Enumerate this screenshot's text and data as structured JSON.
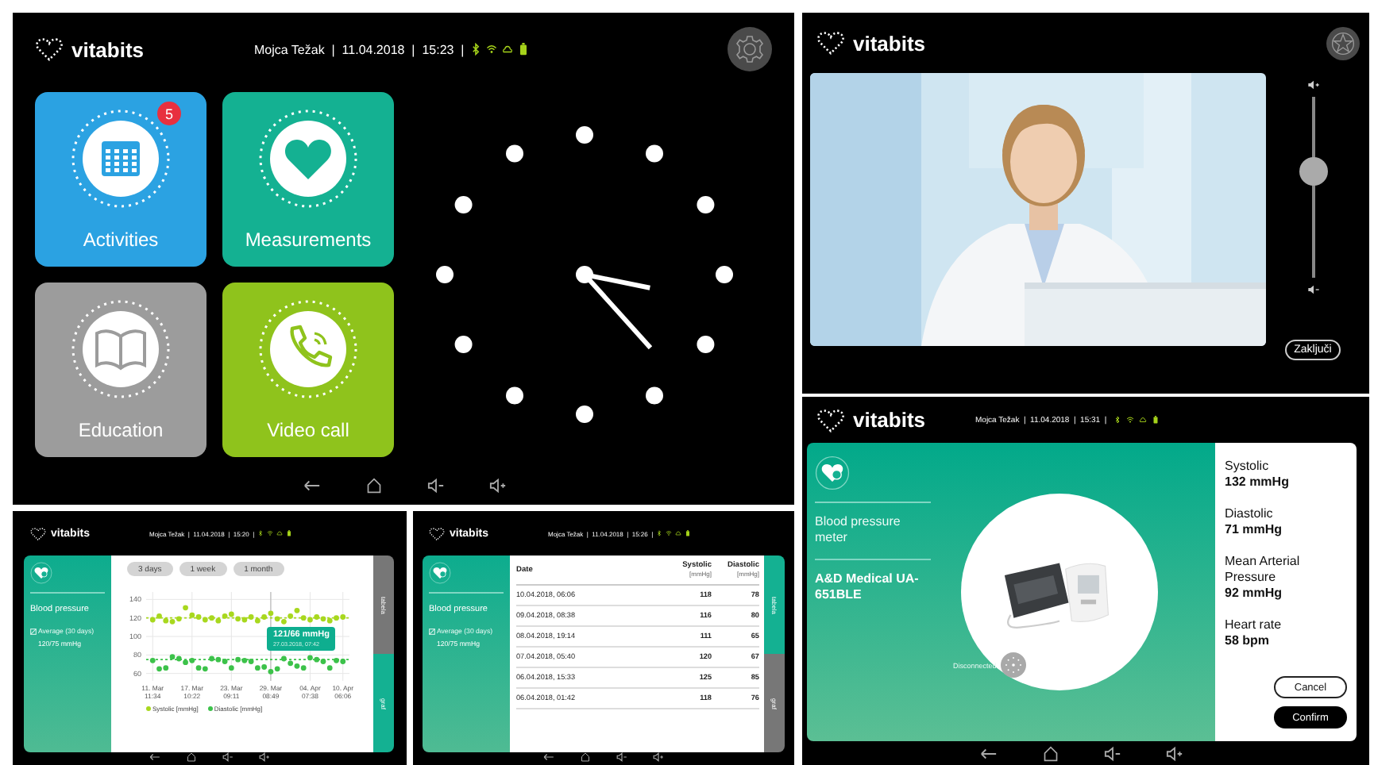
{
  "home_screen": {
    "logo": "vitabits",
    "status": "Mojca Težak  |  11.04.2018  |  15:23  |",
    "tiles": [
      {
        "kind": "calendar",
        "label": "Activities",
        "color": "#2ba2e2",
        "badge": "5"
      },
      {
        "kind": "heart",
        "label": "Measurements",
        "color": "#14b192"
      },
      {
        "kind": "book",
        "label": "Education",
        "color": "#9c9c9c"
      },
      {
        "kind": "phone",
        "label": "Video call",
        "color": "#8fc31c"
      }
    ]
  },
  "video_screen": {
    "logo": "vitabits",
    "volume": {
      "level": 0.6
    },
    "end_button": "Zaključi"
  },
  "chart_screen": {
    "logo": "vitabits",
    "status": "Mojca Težak  |  11.04.2018  |  15:20  |",
    "title": "Blood pressure",
    "average_label": "Average (30 days)",
    "average_value": "120/75 mmHg",
    "ranges": [
      {
        "label": "3 days",
        "selected": false
      },
      {
        "label": "1 week",
        "selected": false
      },
      {
        "label": "1 month",
        "selected": false
      }
    ],
    "chart_data": {
      "type": "scatter",
      "categories": [
        "11. Mar 11:34",
        null,
        null,
        null,
        null,
        null,
        "17. Mar 10:22",
        null,
        null,
        null,
        null,
        null,
        "23. Mar 09:11",
        null,
        null,
        null,
        null,
        null,
        "29. Mar 08:49",
        null,
        null,
        null,
        null,
        null,
        "04. Apr 07:38",
        null,
        null,
        null,
        null,
        "10. Apr 06:06"
      ],
      "series": [
        {
          "name": "Systolic [mmHg]",
          "color": "#a8d81e",
          "values": [
            118,
            122,
            117,
            116,
            119,
            131,
            123,
            121,
            118,
            120,
            117,
            122,
            124,
            119,
            118,
            121,
            117,
            121,
            125,
            119,
            116,
            122,
            128,
            120,
            118,
            121,
            119,
            117,
            120,
            121
          ]
        },
        {
          "name": "Diastolic [mmHg]",
          "color": "#3cc24a",
          "values": [
            74,
            65,
            66,
            78,
            76,
            72,
            74,
            66,
            65,
            76,
            75,
            73,
            66,
            75,
            74,
            73,
            66,
            67,
            62,
            65,
            76,
            71,
            68,
            66,
            77,
            75,
            73,
            66,
            74,
            73
          ]
        }
      ],
      "ylim": [
        52,
        148
      ],
      "grid": true,
      "legend": true,
      "ref_lines": [
        {
          "axis": "y",
          "value": 120,
          "color": "#a8d81e"
        },
        {
          "axis": "y",
          "value": 75,
          "color": "#3cc24a"
        }
      ],
      "yticks": [
        60,
        80,
        100,
        120,
        140
      ]
    },
    "tooltip": {
      "value": "121/66 mmHg",
      "time": "27.03.2018, 07:42"
    },
    "side_tabs": [
      {
        "label": "tabela",
        "selected": false
      },
      {
        "label": "graf",
        "selected": true
      }
    ]
  },
  "table_screen": {
    "logo": "vitabits",
    "status": "Mojca Težak  |  11.04.2018  |  15:26  |",
    "title": "Blood pressure",
    "average_label": "Average (30 days)",
    "average_value": "120/75 mmHg",
    "columns": [
      {
        "label": "Date"
      },
      {
        "label": "Systolic",
        "unit": "[mmHg]"
      },
      {
        "label": "Diastolic",
        "unit": "[mmHg]"
      }
    ],
    "rows": [
      [
        "10.04.2018, 06:06",
        "118",
        "78"
      ],
      [
        "09.04.2018, 08:38",
        "116",
        "80"
      ],
      [
        "08.04.2018, 19:14",
        "111",
        "65"
      ],
      [
        "07.04.2018, 05:40",
        "120",
        "67"
      ],
      [
        "06.04.2018, 15:33",
        "125",
        "85"
      ],
      [
        "06.04.2018, 01:42",
        "118",
        "76"
      ]
    ],
    "side_tabs": [
      {
        "label": "tabela",
        "selected": true
      },
      {
        "label": "graf",
        "selected": false
      }
    ]
  },
  "measurement_screen": {
    "logo": "vitabits",
    "status": "Mojca Težak  |  11.04.2018  |  15:31  |",
    "device_type": "Blood pressure meter",
    "device_name": "A&D Medical UA-651BLE",
    "connection": "Disconnected",
    "readings": [
      {
        "label": "Systolic",
        "value": "132 mmHg"
      },
      {
        "label": "Diastolic",
        "value": "71 mmHg"
      },
      {
        "label": "Mean Arterial Pressure",
        "value": "92 mmHg"
      },
      {
        "label": "Heart rate",
        "value": "58 bpm"
      }
    ],
    "buttons": [
      {
        "kind": "outline",
        "label": "Cancel"
      },
      {
        "kind": "filled",
        "label": "Confirm"
      }
    ]
  }
}
